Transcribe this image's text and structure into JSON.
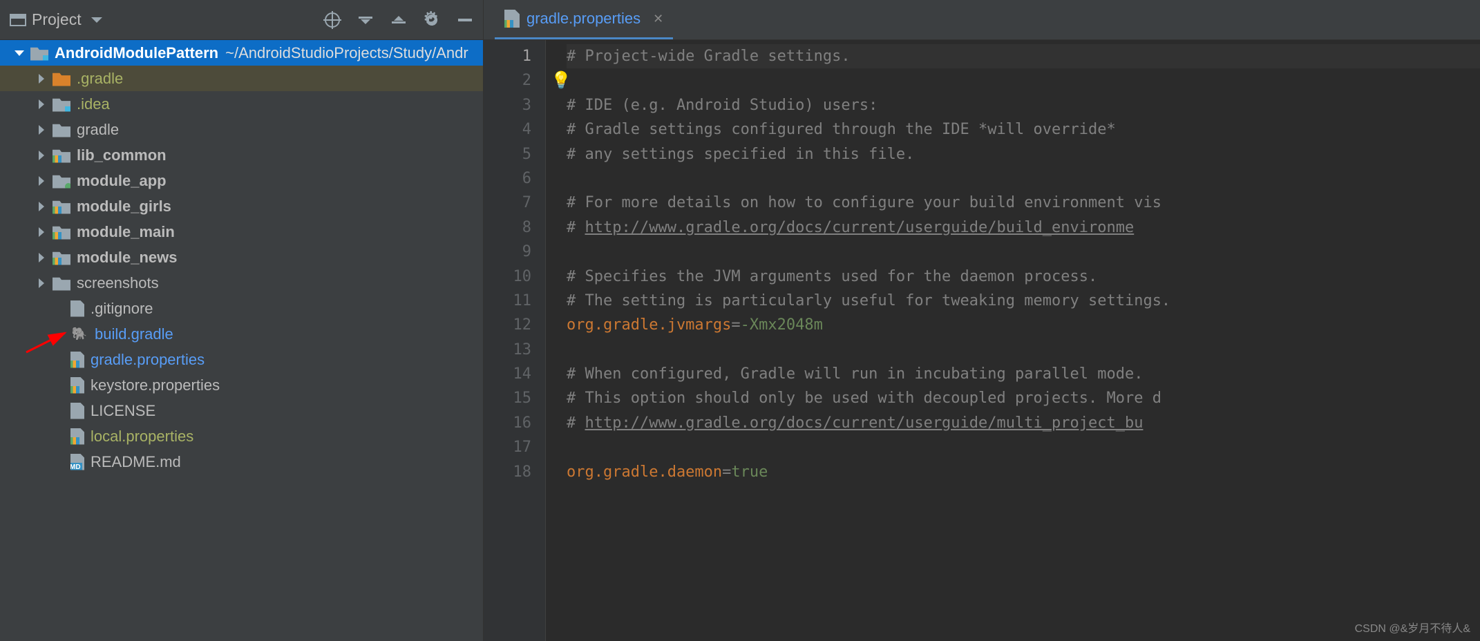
{
  "panel": {
    "title": "Project"
  },
  "tree": [
    {
      "type": "root",
      "indent": 18,
      "chev": "down",
      "icon": "folder-icon blue-overlay",
      "label": "AndroidModulePattern",
      "bold": true,
      "path": "~/AndroidStudioProjects/Study/Andr",
      "selected": true
    },
    {
      "type": "dir",
      "indent": 50,
      "chev": "right",
      "icon": "folder-icon orange",
      "label": ".gradle",
      "color": "olive",
      "highlighted": true
    },
    {
      "type": "dir",
      "indent": 50,
      "chev": "right",
      "icon": "folder-icon blue-overlay",
      "label": ".idea",
      "color": "olive"
    },
    {
      "type": "dir",
      "indent": 50,
      "chev": "right",
      "icon": "folder-icon",
      "label": "gradle"
    },
    {
      "type": "dir",
      "indent": 50,
      "chev": "right",
      "icon": "module-icon",
      "label": "lib_common",
      "bold": true
    },
    {
      "type": "dir",
      "indent": 50,
      "chev": "right",
      "icon": "folder-icon green-dot",
      "label": "module_app",
      "bold": true
    },
    {
      "type": "dir",
      "indent": 50,
      "chev": "right",
      "icon": "module-icon",
      "label": "module_girls",
      "bold": true
    },
    {
      "type": "dir",
      "indent": 50,
      "chev": "right",
      "icon": "module-icon",
      "label": "module_main",
      "bold": true
    },
    {
      "type": "dir",
      "indent": 50,
      "chev": "right",
      "icon": "module-icon",
      "label": "module_news",
      "bold": true
    },
    {
      "type": "dir",
      "indent": 50,
      "chev": "right",
      "icon": "folder-icon",
      "label": "screenshots"
    },
    {
      "type": "file",
      "indent": 76,
      "icon": "file-icon",
      "label": ".gitignore"
    },
    {
      "type": "file",
      "indent": 76,
      "icon": "elephant-icon",
      "label": "build.gradle",
      "color": "blue-text"
    },
    {
      "type": "file",
      "indent": 76,
      "icon": "file-icon bars",
      "label": "gradle.properties",
      "color": "blue-text"
    },
    {
      "type": "file",
      "indent": 76,
      "icon": "file-icon bars",
      "label": "keystore.properties"
    },
    {
      "type": "file",
      "indent": 76,
      "icon": "file-icon",
      "label": "LICENSE"
    },
    {
      "type": "file",
      "indent": 76,
      "icon": "file-icon bars",
      "label": "local.properties",
      "color": "olive"
    },
    {
      "type": "file",
      "indent": 76,
      "icon": "file-icon md",
      "label": "README.md"
    }
  ],
  "tab": {
    "label": "gradle.properties"
  },
  "editor": {
    "lines": [
      {
        "n": 1,
        "current": true,
        "segments": [
          {
            "t": "# Project-wide Gradle settings.",
            "c": "comment"
          }
        ]
      },
      {
        "n": 2,
        "segments": []
      },
      {
        "n": 3,
        "segments": [
          {
            "t": "# IDE (e.g. Android Studio) users:",
            "c": "comment"
          }
        ]
      },
      {
        "n": 4,
        "segments": [
          {
            "t": "# Gradle settings configured through the IDE *will override*",
            "c": "comment"
          }
        ]
      },
      {
        "n": 5,
        "segments": [
          {
            "t": "# any settings specified in this file.",
            "c": "comment"
          }
        ]
      },
      {
        "n": 6,
        "segments": []
      },
      {
        "n": 7,
        "segments": [
          {
            "t": "# For more details on how to configure your build environment vis",
            "c": "comment"
          }
        ]
      },
      {
        "n": 8,
        "segments": [
          {
            "t": "# ",
            "c": "comment"
          },
          {
            "t": "http://www.gradle.org/docs/current/userguide/build_environme",
            "c": "comment link"
          }
        ]
      },
      {
        "n": 9,
        "segments": []
      },
      {
        "n": 10,
        "segments": [
          {
            "t": "# Specifies the JVM arguments used for the daemon process.",
            "c": "comment"
          }
        ]
      },
      {
        "n": 11,
        "segments": [
          {
            "t": "# The setting is particularly useful for tweaking memory settings.",
            "c": "comment"
          }
        ]
      },
      {
        "n": 12,
        "segments": [
          {
            "t": "org.gradle.jvmargs",
            "c": "property-key"
          },
          {
            "t": "=",
            "c": "equals"
          },
          {
            "t": "-Xmx2048m",
            "c": "property-val"
          }
        ]
      },
      {
        "n": 13,
        "segments": []
      },
      {
        "n": 14,
        "segments": [
          {
            "t": "# When configured, Gradle will run in incubating parallel mode.",
            "c": "comment"
          }
        ]
      },
      {
        "n": 15,
        "segments": [
          {
            "t": "# This option should only be used with decoupled projects. More d",
            "c": "comment"
          }
        ]
      },
      {
        "n": 16,
        "segments": [
          {
            "t": "# ",
            "c": "comment"
          },
          {
            "t": "http://www.gradle.org/docs/current/userguide/multi_project_bu",
            "c": "comment link"
          }
        ]
      },
      {
        "n": 17,
        "segments": []
      },
      {
        "n": 18,
        "segments": [
          {
            "t": "org.gradle.daemon",
            "c": "property-key"
          },
          {
            "t": "=",
            "c": "equals"
          },
          {
            "t": "true",
            "c": "property-val"
          }
        ]
      }
    ]
  },
  "watermark": "CSDN @&岁月不待人&"
}
